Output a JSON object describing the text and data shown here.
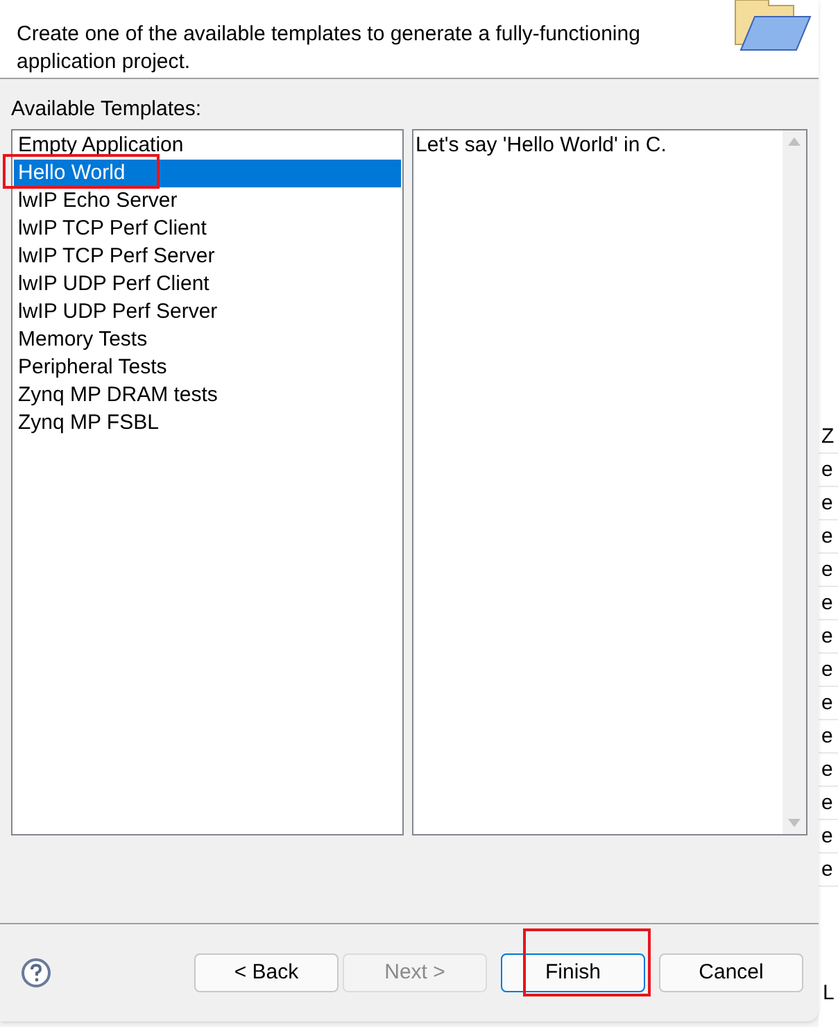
{
  "header": {
    "description": "Create one of the available templates to generate a fully-functioning application project."
  },
  "templates_label": "Available Templates:",
  "templates": [
    {
      "label": "Empty Application",
      "selected": false,
      "highlighted": false
    },
    {
      "label": "Hello World",
      "selected": true,
      "highlighted": true
    },
    {
      "label": "lwIP Echo Server",
      "selected": false,
      "highlighted": false
    },
    {
      "label": "lwIP TCP Perf Client",
      "selected": false,
      "highlighted": false
    },
    {
      "label": "lwIP TCP Perf Server",
      "selected": false,
      "highlighted": false
    },
    {
      "label": "lwIP UDP Perf Client",
      "selected": false,
      "highlighted": false
    },
    {
      "label": "lwIP UDP Perf Server",
      "selected": false,
      "highlighted": false
    },
    {
      "label": "Memory Tests",
      "selected": false,
      "highlighted": false
    },
    {
      "label": "Peripheral Tests",
      "selected": false,
      "highlighted": false
    },
    {
      "label": "Zynq MP DRAM tests",
      "selected": false,
      "highlighted": false
    },
    {
      "label": "Zynq MP FSBL",
      "selected": false,
      "highlighted": false
    }
  ],
  "description_text": "Let's say 'Hello World' in C.",
  "buttons": [
    {
      "label": "< Back",
      "disabled": false,
      "default": false,
      "highlighted": false
    },
    {
      "label": "Next >",
      "disabled": true,
      "default": false,
      "highlighted": false
    },
    {
      "label": "Finish",
      "disabled": false,
      "default": true,
      "highlighted": true
    },
    {
      "label": "Cancel",
      "disabled": false,
      "default": false,
      "highlighted": false
    }
  ],
  "background_window": {
    "rows": [
      "Z",
      "e",
      "e",
      "e",
      "e",
      "e",
      "e",
      "e",
      "e",
      "e",
      "e",
      "e",
      "e",
      "e"
    ],
    "footer": "L"
  }
}
